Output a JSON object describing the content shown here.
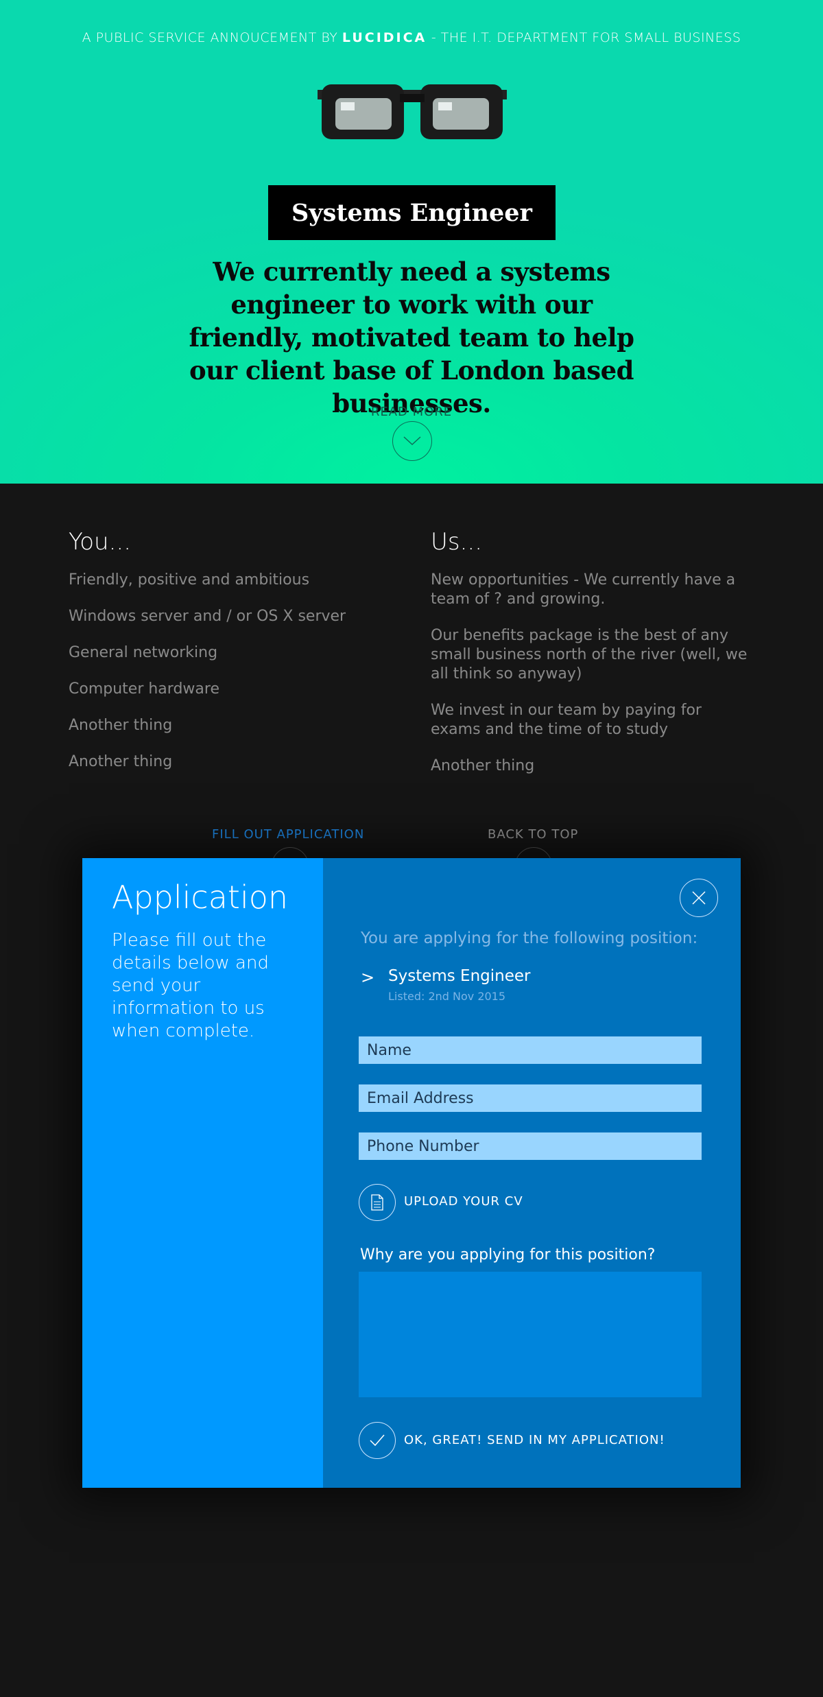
{
  "hero": {
    "psa_prefix": "A PUBLIC SERVICE ANNOUCEMENT BY ",
    "brand": "LUCIDICA",
    "psa_suffix": " - THE I.T. DEPARTMENT FOR SMALL BUSINESS",
    "job_title": "Systems Engineer",
    "intro": "We currently need a systems engineer to work with our friendly, motivated team to help our client base of London based businesses.",
    "read_more": "READ MORE"
  },
  "you": {
    "heading": "You...",
    "items": [
      "Friendly, positive and ambitious",
      "Windows server and / or OS X server",
      "General networking",
      "Computer hardware",
      "Another thing",
      "Another thing"
    ]
  },
  "us": {
    "heading": "Us...",
    "items": [
      "New opportunities - We currently have a team of  ? and growing.",
      "Our benefits package is the best of any small business north of the river (well, we all think so anyway)",
      "We invest in our team by paying for exams and the time of to study",
      "Another thing"
    ]
  },
  "links": {
    "fill_out": "FILL OUT APPLICATION",
    "back_to_top": "BACK TO TOP"
  },
  "modal": {
    "title": "Application",
    "description": "Please fill out the details below and send your information to us when complete.",
    "applying_for": "You are applying for the following position:",
    "position_arrow": ">",
    "position_name": "Systems Engineer",
    "position_listed": "Listed: 2nd Nov 2015",
    "name_placeholder": "Name",
    "email_placeholder": "Email Address",
    "phone_placeholder": "Phone Number",
    "upload_label": "UPLOAD YOUR CV",
    "why_label": "Why are you applying for this position?",
    "send_label": "OK, GREAT! SEND IN MY APPLICATION!"
  },
  "icons": {
    "glasses": "glasses-icon",
    "chevron": "chevron-down-icon",
    "close": "close-icon",
    "document": "document-icon",
    "check": "check-icon"
  },
  "colors": {
    "hero_bg": "#05e4a2",
    "page_bg": "#151515",
    "modal_left": "#0099ff",
    "modal_right": "#0072bc",
    "field_bg": "#99d5fe",
    "link_blue": "#1e88e5"
  }
}
